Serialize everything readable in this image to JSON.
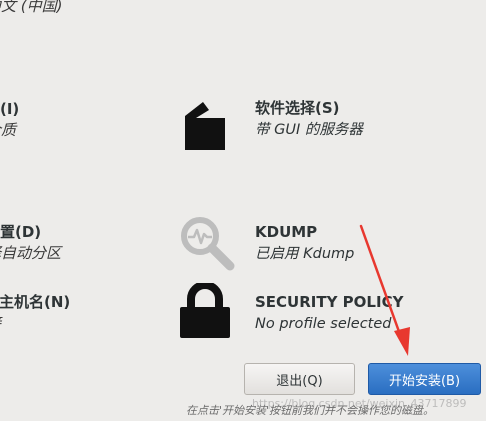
{
  "left_column": {
    "language_sub": "中文 (中国)",
    "source_title": "源(I)",
    "source_sub": "介质",
    "destination_title": "位置(D)",
    "destination_sub": "择自动分区",
    "network_title": "和主机名(N)",
    "network_sub": "接"
  },
  "items": {
    "software": {
      "title": "软件选择(S)",
      "subtitle": "带 GUI 的服务器",
      "icon": "package-icon"
    },
    "kdump": {
      "title": "KDUMP",
      "subtitle": "已启用 Kdump",
      "icon": "kdump-search-icon"
    },
    "security": {
      "title": "SECURITY POLICY",
      "subtitle": "No profile selected",
      "icon": "lock-icon"
    }
  },
  "buttons": {
    "quit_label": "退出(Q)",
    "install_label": "开始安装(B)"
  },
  "footnote": "在点击'开始安装'按钮前我们并不会操作您的磁盘。",
  "watermark": "https://blog.csdn.net/weixin_43717899",
  "colors": {
    "background": "#edecea",
    "install_button": "#3b7fcf",
    "annotation_arrow": "#e8382f"
  }
}
